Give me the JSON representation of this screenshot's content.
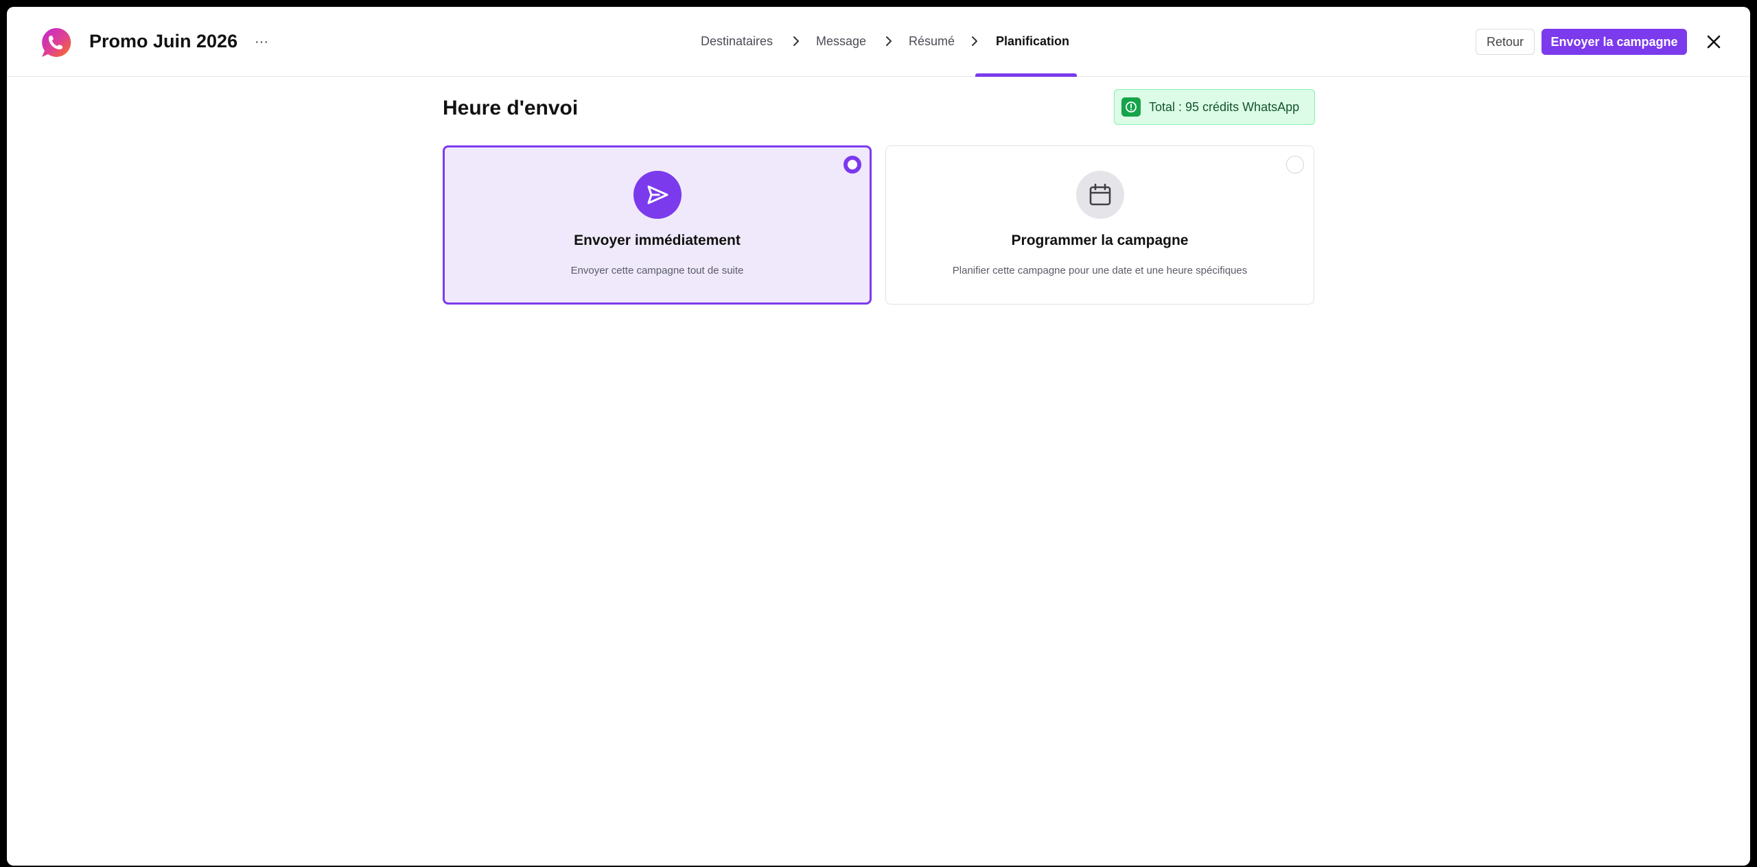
{
  "header": {
    "title": "Promo Juin 2026",
    "more_label": "···",
    "steps": [
      {
        "label": "Destinataires",
        "state": "done"
      },
      {
        "label": "Message",
        "state": "done"
      },
      {
        "label": "Résumé",
        "state": "done"
      },
      {
        "label": "Planification",
        "state": "active"
      }
    ],
    "back_label": "Retour",
    "send_label": "Envoyer la campagne"
  },
  "main": {
    "section_title": "Heure d'envoi",
    "credits_text": "Total : 95 crédits WhatsApp",
    "options": [
      {
        "title": "Envoyer immédiatement",
        "description": "Envoyer cette campagne tout de suite",
        "icon": "send-icon",
        "selected": true
      },
      {
        "title": "Programmer la campagne",
        "description": "Planifier cette campagne pour une date et une heure spécifiques",
        "icon": "calendar-icon",
        "selected": false
      }
    ]
  },
  "colors": {
    "accent": "#7c3aed",
    "accent_light": "#efe9fb",
    "credits_bg": "#dcfce7",
    "credits_icon": "#16a34a"
  }
}
